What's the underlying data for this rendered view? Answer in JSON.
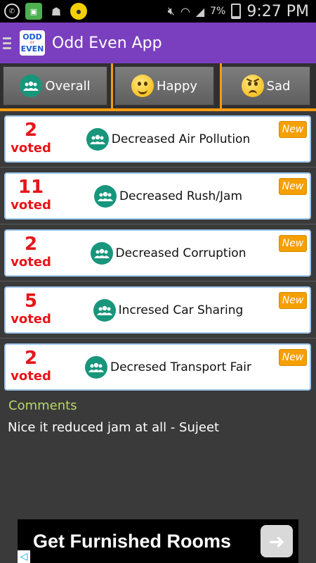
{
  "status_bar": {
    "battery": "7%",
    "time": "9:27 PM"
  },
  "app": {
    "title": "Odd Even App",
    "logo_top": "ODD",
    "logo_mid": "or",
    "logo_bottom": "EVEN"
  },
  "tabs": [
    {
      "label": "Overall"
    },
    {
      "label": "Happy"
    },
    {
      "label": "Sad"
    }
  ],
  "cards": [
    {
      "count": "2",
      "voted_label": "voted",
      "title": "Decreased Air Pollution",
      "badge": "New"
    },
    {
      "count": "11",
      "voted_label": "voted",
      "title": "Decreased Rush/Jam",
      "badge": "New"
    },
    {
      "count": "2",
      "voted_label": "voted",
      "title": "Decreased Corruption",
      "badge": "New"
    },
    {
      "count": "5",
      "voted_label": "voted",
      "title": "Incresed Car Sharing",
      "badge": "New"
    },
    {
      "count": "2",
      "voted_label": "voted",
      "title": "Decresed Transport Fair",
      "badge": "New"
    }
  ],
  "comments": {
    "heading": "Comments",
    "items": [
      "Nice it reduced jam at all - Sujeet"
    ]
  },
  "ad": {
    "text": "Get Furnished Rooms"
  },
  "colors": {
    "appbar": "#7a3fbf",
    "accent": "#f39c12",
    "vote_red": "#e8141a",
    "badge": "#f5a000",
    "group_icon": "#17967b"
  }
}
